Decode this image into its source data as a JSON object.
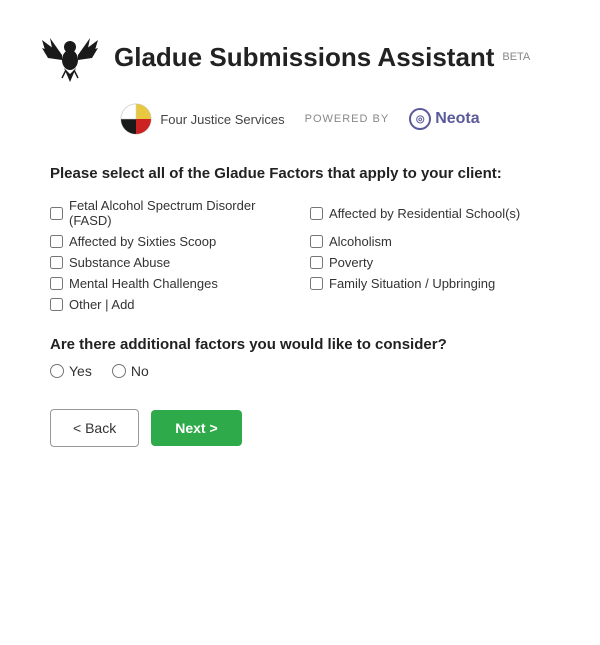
{
  "header": {
    "title": "Gladue Submissions Assistant",
    "beta": "BETA",
    "powered_by": "POWERED BY",
    "neota_label": "Neota",
    "four_justice_label": "Four Justice Services"
  },
  "form": {
    "question1": "Please select all of the Gladue Factors that apply to your client:",
    "checkboxes": [
      {
        "id": "fasd",
        "label": "Fetal Alcohol Spectrum Disorder (FASD)",
        "checked": false
      },
      {
        "id": "residential",
        "label": "Affected by Residential School(s)",
        "checked": false
      },
      {
        "id": "sixties",
        "label": "Affected by Sixties Scoop",
        "checked": false
      },
      {
        "id": "alcoholism",
        "label": "Alcoholism",
        "checked": false
      },
      {
        "id": "substance",
        "label": "Substance Abuse",
        "checked": false
      },
      {
        "id": "poverty",
        "label": "Poverty",
        "checked": false
      },
      {
        "id": "mental",
        "label": "Mental Health Challenges",
        "checked": false
      },
      {
        "id": "family",
        "label": "Family Situation / Upbringing",
        "checked": false
      },
      {
        "id": "other",
        "label": "Other | Add",
        "checked": false
      }
    ],
    "question2": "Are there additional factors you would like to consider?",
    "radio_options": [
      {
        "id": "yes",
        "label": "Yes"
      },
      {
        "id": "no",
        "label": "No"
      }
    ]
  },
  "buttons": {
    "back": "< Back",
    "next": "Next >"
  }
}
